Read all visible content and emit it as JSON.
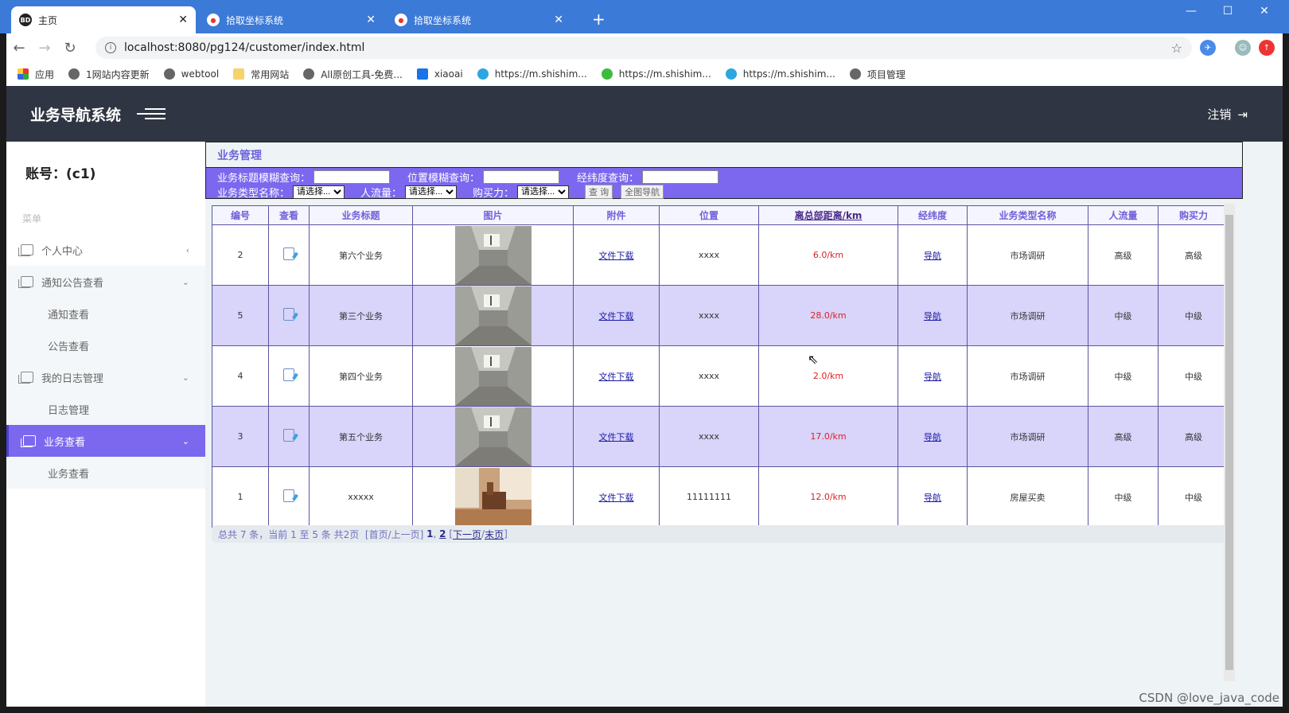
{
  "browser": {
    "tabs": [
      {
        "title": "主页",
        "icon": "baidu-icon",
        "active": true
      },
      {
        "title": "拾取坐标系统",
        "icon": "map-pin-icon",
        "active": false
      },
      {
        "title": "拾取坐标系统",
        "icon": "map-pin-icon",
        "active": false
      }
    ],
    "url": "localhost:8080/pg124/customer/index.html",
    "bookmarks": [
      "应用",
      "1网站内容更新",
      "webtool",
      "常用网站",
      "All原创工具-免费...",
      "xiaoai",
      "https://m.shishim...",
      "https://m.shishim...",
      "https://m.shishim...",
      "项目管理"
    ]
  },
  "header": {
    "title": "业务导航系统",
    "logout": "注销"
  },
  "sidebar": {
    "account": "账号：(c1)",
    "caption": "菜单",
    "items": [
      {
        "label": "个人中心"
      },
      {
        "label": "通知公告查看",
        "subs": [
          "通知查看",
          "公告查看"
        ]
      },
      {
        "label": "我的日志管理",
        "subs": [
          "日志管理"
        ]
      },
      {
        "label": "业务查看",
        "subs": [
          "业务查看"
        ]
      }
    ]
  },
  "panel": {
    "title": "业务管理",
    "search": {
      "title_label": "业务标题模糊查询：",
      "location_label": "位置模糊查询：",
      "latlng_label": "经纬度查询：",
      "type_label": "业务类型名称：",
      "traffic_label": "人流量：",
      "purchase_label": "购买力：",
      "select_placeholder": "请选择...",
      "query_button": "查 询",
      "map_button": "全图导航"
    }
  },
  "table": {
    "headers": [
      "编号",
      "查看",
      "业务标题",
      "图片",
      "附件",
      "位置",
      "离总部距离/km",
      "经纬度",
      "业务类型名称",
      "人流量",
      "购买力"
    ],
    "rows": [
      {
        "id": "2",
        "title": "第六个业务",
        "attachment": "文件下载",
        "location": "xxxx",
        "distance": "6.0/km",
        "nav": "导航",
        "type": "市场调研",
        "traffic": "高级",
        "purchase": "高级",
        "photo": "empty-room"
      },
      {
        "id": "5",
        "title": "第三个业务",
        "attachment": "文件下载",
        "location": "xxxx",
        "distance": "28.0/km",
        "nav": "导航",
        "type": "市场调研",
        "traffic": "中级",
        "purchase": "中级",
        "photo": "empty-room"
      },
      {
        "id": "4",
        "title": "第四个业务",
        "attachment": "文件下载",
        "location": "xxxx",
        "distance": "2.0/km",
        "nav": "导航",
        "type": "市场调研",
        "traffic": "中级",
        "purchase": "中级",
        "photo": "empty-room"
      },
      {
        "id": "3",
        "title": "第五个业务",
        "attachment": "文件下载",
        "location": "xxxx",
        "distance": "17.0/km",
        "nav": "导航",
        "type": "市场调研",
        "traffic": "高级",
        "purchase": "高级",
        "photo": "empty-room"
      },
      {
        "id": "1",
        "title": "xxxxx",
        "attachment": "文件下载",
        "location": "11111111",
        "distance": "12.0/km",
        "nav": "导航",
        "type": "房屋买卖",
        "traffic": "中级",
        "purchase": "中级",
        "photo": "furnished-room"
      }
    ]
  },
  "pager": {
    "summary": "总共 7 条，当前 1 至 5 条 共2页",
    "first_prev": "[首页/上一页]",
    "page1": "1",
    "page2": "2",
    "next_last_open": "[",
    "next": "下一页",
    "slash": "/",
    "last": "末页",
    "next_last_close": "]"
  },
  "watermark": "CSDN @love_java_code",
  "colors": {
    "accent": "#7b68ee",
    "header_bg": "#2f3542",
    "distance_text": "#dd2222",
    "browser_blue": "#3c7ad8"
  }
}
